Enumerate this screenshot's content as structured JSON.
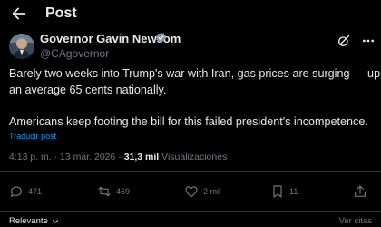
{
  "header": {
    "title": "Post"
  },
  "author": {
    "name": "Governor Gavin Newsom",
    "handle": "@CAgovernor"
  },
  "post": {
    "line1": "Barely two weeks into Trump's war with Iran, gas prices are surging — up",
    "line2": "an average 65 cents nationally.",
    "line3": "Americans keep footing the bill for this failed president's incompetence.",
    "translate_label": "Traducir post"
  },
  "meta": {
    "time": "4:13 p. m.",
    "sep1": " · ",
    "date": "13 mar. 2026",
    "sep2": " · ",
    "views": "31,3 mil",
    "views_label": "Visualizaciones"
  },
  "actions": {
    "replies": "471",
    "reposts": "469",
    "likes": "2 mil",
    "bookmarks": "11"
  },
  "replies_sort": {
    "left": "Relevante",
    "right": "Ver citas"
  },
  "colors": {
    "accent": "#1d9bf0",
    "muted": "#71767b",
    "text": "#e7e9ea",
    "background": "#000000"
  }
}
